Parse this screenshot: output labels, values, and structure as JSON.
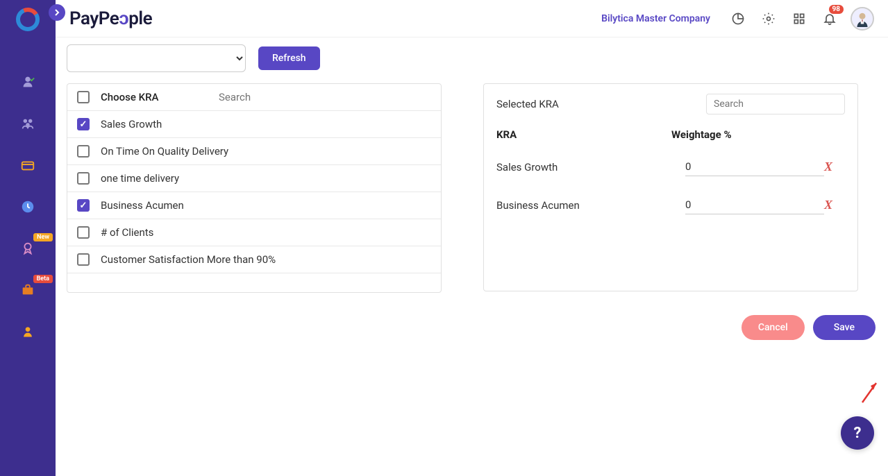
{
  "header": {
    "brand": "PayPeople",
    "company": "Bilytica Master Company",
    "notification_count": "98"
  },
  "sidebar": {
    "badges": {
      "new": "New",
      "beta": "Beta"
    }
  },
  "toolbar": {
    "refresh_label": "Refresh",
    "dropdown_value": ""
  },
  "left_panel": {
    "choose_label": "Choose KRA",
    "search_placeholder": "Search",
    "items": [
      {
        "label": "Sales Growth",
        "checked": true
      },
      {
        "label": "On Time On Quality Delivery",
        "checked": false
      },
      {
        "label": "one time delivery",
        "checked": false
      },
      {
        "label": "Business Acumen",
        "checked": true
      },
      {
        "label": "# of Clients",
        "checked": false
      },
      {
        "label": "Customer Satisfaction More than 90%",
        "checked": false
      }
    ]
  },
  "right_panel": {
    "title": "Selected KRA",
    "search_placeholder": "Search",
    "col_kra": "KRA",
    "col_weight": "Weightage %",
    "rows": [
      {
        "kra": "Sales Growth",
        "weight": "0"
      },
      {
        "kra": "Business Acumen",
        "weight": "0"
      }
    ]
  },
  "actions": {
    "cancel": "Cancel",
    "save": "Save"
  },
  "help": "?",
  "delete_glyph": "X"
}
